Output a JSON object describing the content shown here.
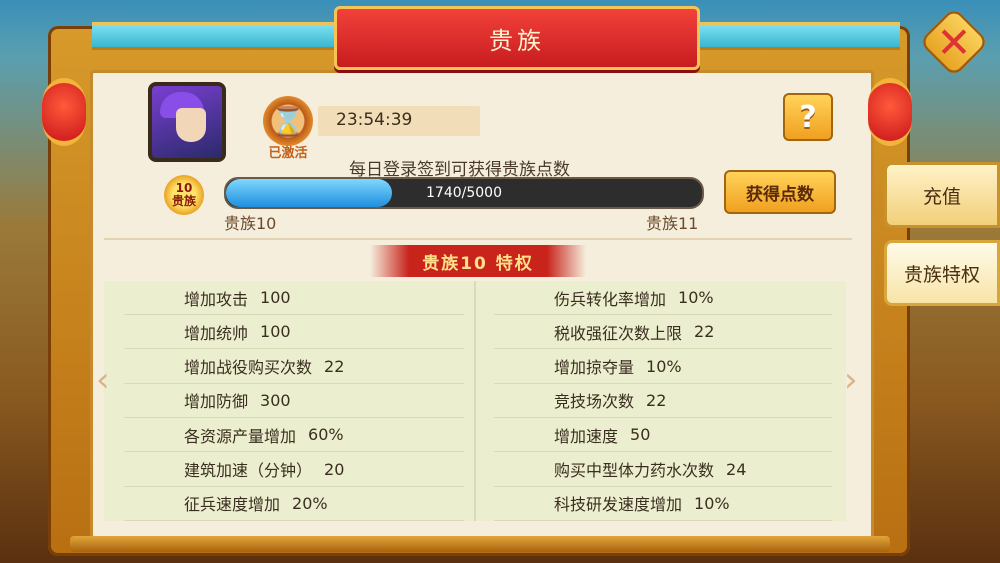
{
  "window": {
    "title": "贵族"
  },
  "header": {
    "status": "已激活",
    "timer": "23:54:39",
    "help_label": "?",
    "daily_tip": "每日登录签到可获得贵族点数",
    "badge_level": "10",
    "badge_label": "贵族",
    "progress": {
      "text": "1740/5000",
      "current": 1740,
      "max": 5000
    },
    "current_level": "贵族10",
    "next_level": "贵族11",
    "get_points_label": "获得点数"
  },
  "privilege_title": "贵族10 特权",
  "privileges": {
    "left": [
      {
        "name": "增加攻击",
        "value": "100"
      },
      {
        "name": "增加统帅",
        "value": "100"
      },
      {
        "name": "增加战役购买次数",
        "value": "22"
      },
      {
        "name": "增加防御",
        "value": "300"
      },
      {
        "name": "各资源产量增加",
        "value": "60%"
      },
      {
        "name": "建筑加速（分钟）",
        "value": "20"
      },
      {
        "name": "征兵速度增加",
        "value": "20%"
      }
    ],
    "right": [
      {
        "name": "伤兵转化率增加",
        "value": "10%"
      },
      {
        "name": "税收强征次数上限",
        "value": "22"
      },
      {
        "name": "增加掠夺量",
        "value": "10%"
      },
      {
        "name": "竞技场次数",
        "value": "22"
      },
      {
        "name": "增加速度",
        "value": "50"
      },
      {
        "name": "购买中型体力药水次数",
        "value": "24"
      },
      {
        "name": "科技研发速度增加",
        "value": "10%"
      }
    ]
  },
  "side_tabs": [
    {
      "label": "充值"
    },
    {
      "label": "贵族特权"
    }
  ],
  "nav": {
    "prev": "‹",
    "next": "›"
  },
  "icons": {
    "close": "close-icon",
    "hourglass": "hourglass-icon",
    "avatar": "hero-avatar"
  }
}
